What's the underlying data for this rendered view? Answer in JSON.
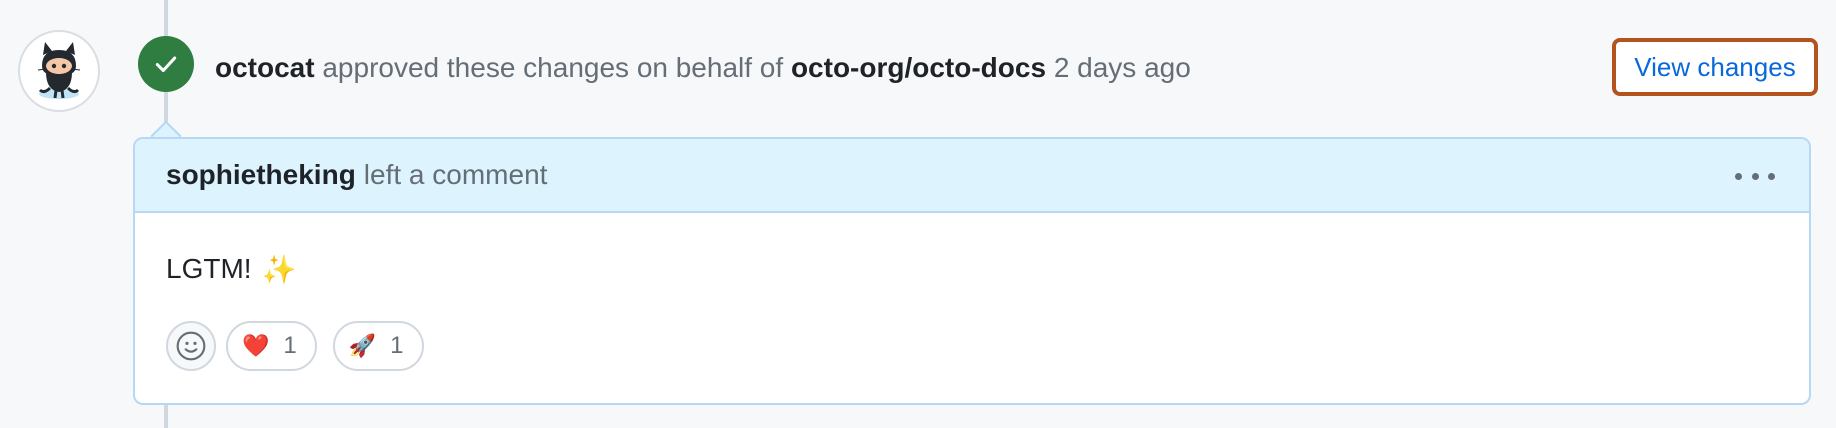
{
  "review": {
    "user": "octocat",
    "action_text": "approved these changes on behalf of",
    "org_repo": "octo-org/octo-docs",
    "time_ago": "2 days ago",
    "view_changes_label": "View changes"
  },
  "comment": {
    "author": "sophietheking",
    "action_text": "left a comment",
    "body_text": "LGTM!",
    "body_emoji": "✨"
  },
  "reactions": [
    {
      "emoji": "❤️",
      "count": "1"
    },
    {
      "emoji": "🚀",
      "count": "1"
    }
  ],
  "colors": {
    "approved_badge": "#2f7d40",
    "link": "#0969da",
    "highlight_border": "#b3541e",
    "comment_header_bg": "#ddf4ff"
  },
  "icons": {
    "avatar": "octocat-avatar-icon",
    "badge": "check-icon",
    "menu": "kebab-horizontal-icon",
    "add_reaction": "smiley-icon"
  }
}
